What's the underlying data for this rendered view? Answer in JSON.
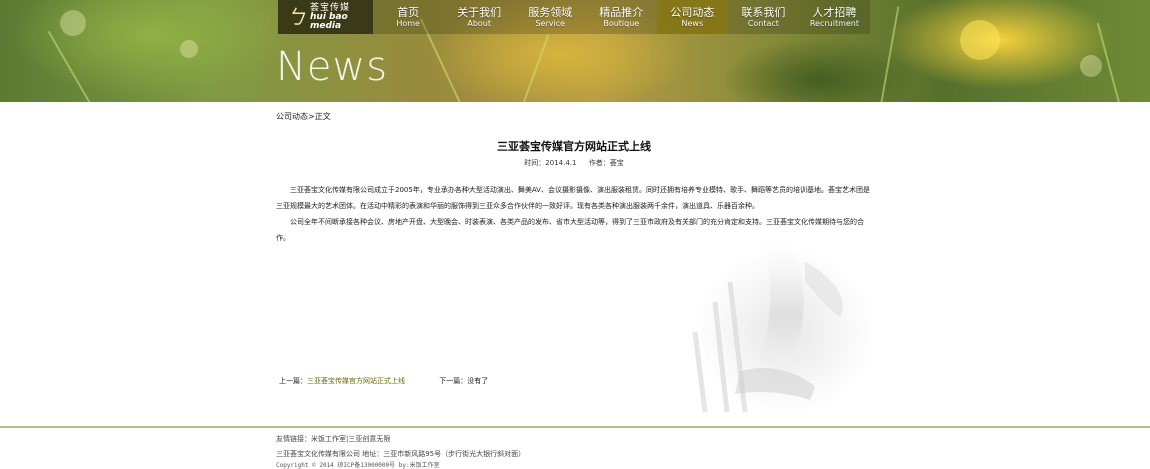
{
  "logo": {
    "mark": "ㄅ",
    "cn": "荟宝传媒",
    "en": "hui bao media"
  },
  "nav": [
    {
      "cn": "首页",
      "en": "Home"
    },
    {
      "cn": "关于我们",
      "en": "About"
    },
    {
      "cn": "服务领域",
      "en": "Service"
    },
    {
      "cn": "精品推介",
      "en": "Boutique"
    },
    {
      "cn": "公司动态",
      "en": "News"
    },
    {
      "cn": "联系我们",
      "en": "Contact"
    },
    {
      "cn": "人才招聘",
      "en": "Recruitment"
    }
  ],
  "active_nav": "公司动态",
  "banner": {
    "title": "News"
  },
  "breadcrumb": "公司动态>正文",
  "article": {
    "title": "三亚荟宝传媒官方网站正式上线",
    "date": "时间：2014.4.1",
    "author": "作者：荟宝",
    "paragraphs": [
      "三亚荟宝文化传媒有限公司成立于2005年，专业承办各种大型活动演出、舞美AV、会议摄影摄像、演出服装租赁。同时还拥有培养专业模特、歌手、舞蹈等艺员的培训基地。荟宝艺术团是三亚规模最大的艺术团体。在活动中精彩的表演和华丽的服饰得到三亚众多合作伙伴的一致好评。现有各类各种演出服装两千余件，演出道具、乐器百余种。",
      "公司全年不间断承接各种会议、房地产开盘、大型晚会、时装表演、各类产品的发布、省市大型活动等，得到了三亚市政府及有关部门的充分肯定和支持。三亚荟宝文化传媒期待与您的合作。"
    ]
  },
  "prevnext": {
    "prev_label": "上一篇：",
    "prev_link": "三亚荟宝传媒官方网站正式上线",
    "next_label": "下一篇：",
    "next_value": "没有了"
  },
  "footer": {
    "links_label": "友情链接：",
    "links": [
      "米饭工作室",
      "三亚创意无限"
    ],
    "link_separator": "|",
    "company": "三亚荟宝文化传媒有限公司 地址：三亚市新风路95号（步行街光大银行斜对面）",
    "copyright": "Copyright © 2014 琼ICP备13000000号 by:米饭工作室"
  },
  "colors": {
    "accent": "#877814",
    "footer_line": "#b7bd8b",
    "link": "#6b6b00"
  }
}
